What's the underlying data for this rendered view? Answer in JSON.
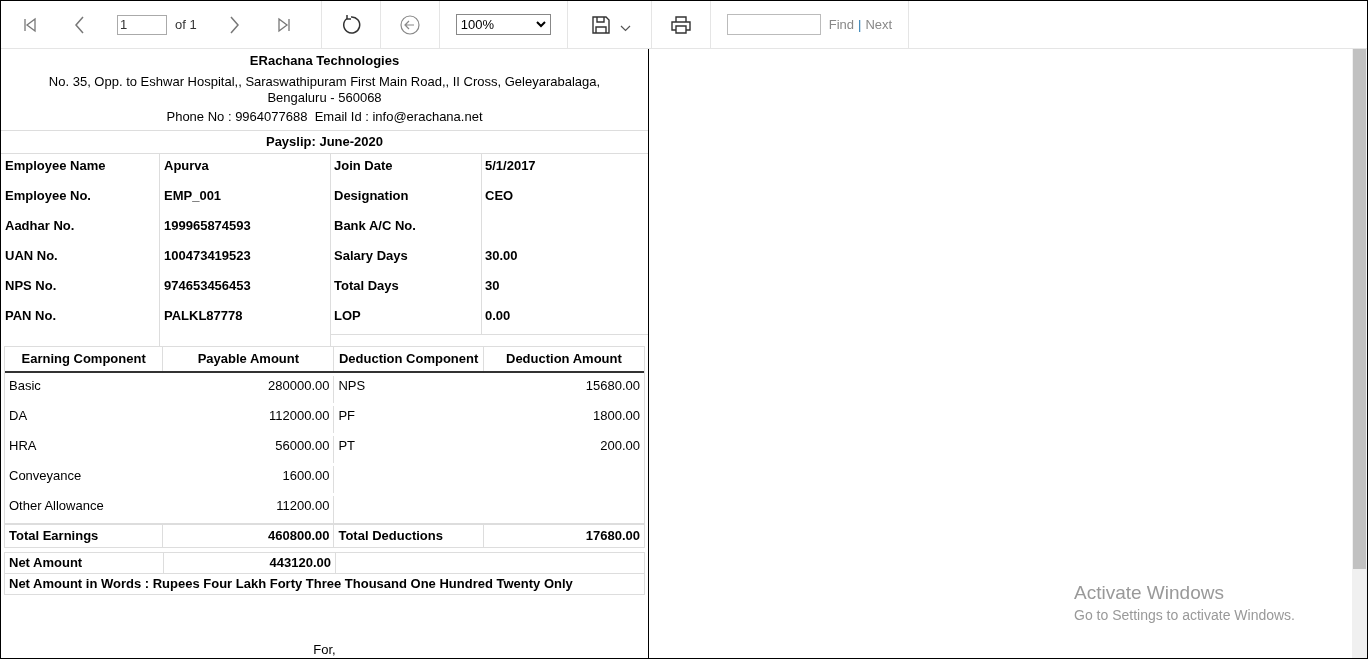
{
  "toolbar": {
    "page_input": "1",
    "page_of": "of 1",
    "zoom": "100%",
    "find_label": "Find",
    "separator": "|",
    "next_label": "Next"
  },
  "report": {
    "company": "ERachana Technologies",
    "address": "No. 35, Opp. to Eshwar Hospital,, Saraswathipuram First Main Road,, II Cross, Geleyarabalaga, Bengaluru - 560068",
    "contact": "Phone No : 9964077688  Email Id : info@erachana.net",
    "title": "Payslip: June-2020",
    "details": [
      {
        "label": "Employee Name",
        "value": "Apurva",
        "label_2": "Join Date",
        "value_2": "5/1/2017"
      },
      {
        "label": "Employee No.",
        "value": "EMP_001",
        "label_2": "Designation",
        "value_2": "CEO"
      },
      {
        "label": "Aadhar No.",
        "value": "199965874593",
        "label_2": "Bank A/C No."
      },
      {
        "label": "UAN No.",
        "value": "100473419523",
        "label_2": "Salary Days",
        "value_2": "30.00"
      },
      {
        "label": "NPS No.",
        "value": "974653456453",
        "label_2": "Total Days",
        "value_2": "30"
      },
      {
        "label": "PAN No.",
        "value": "PALKL87778",
        "label_2": "LOP",
        "value_2": "0.00"
      }
    ],
    "columns": [
      "Earning Component",
      "Payable Amount",
      "Deduction Component",
      "Deduction Amount"
    ],
    "rows": [
      [
        "Basic",
        "280000.00",
        "NPS",
        "15680.00"
      ],
      [
        "DA",
        "112000.00",
        "PF",
        "1800.00"
      ],
      [
        "HRA",
        "56000.00",
        "PT",
        "200.00"
      ],
      [
        "Conveyance",
        "1600.00",
        "",
        ""
      ],
      [
        "Other Allowance",
        "11200.00",
        "",
        ""
      ]
    ],
    "totals": [
      "Total Earnings",
      "460800.00",
      "Total Deductions",
      "17680.00"
    ],
    "net": [
      "Net Amount",
      "443120.00"
    ],
    "net_words": "Net Amount in Words : Rupees Four Lakh Forty Three Thousand One Hundred Twenty Only",
    "footer": "For,"
  },
  "os_notice": {
    "title": "Activate Windows",
    "subtitle": "Go to Settings to activate Windows."
  }
}
